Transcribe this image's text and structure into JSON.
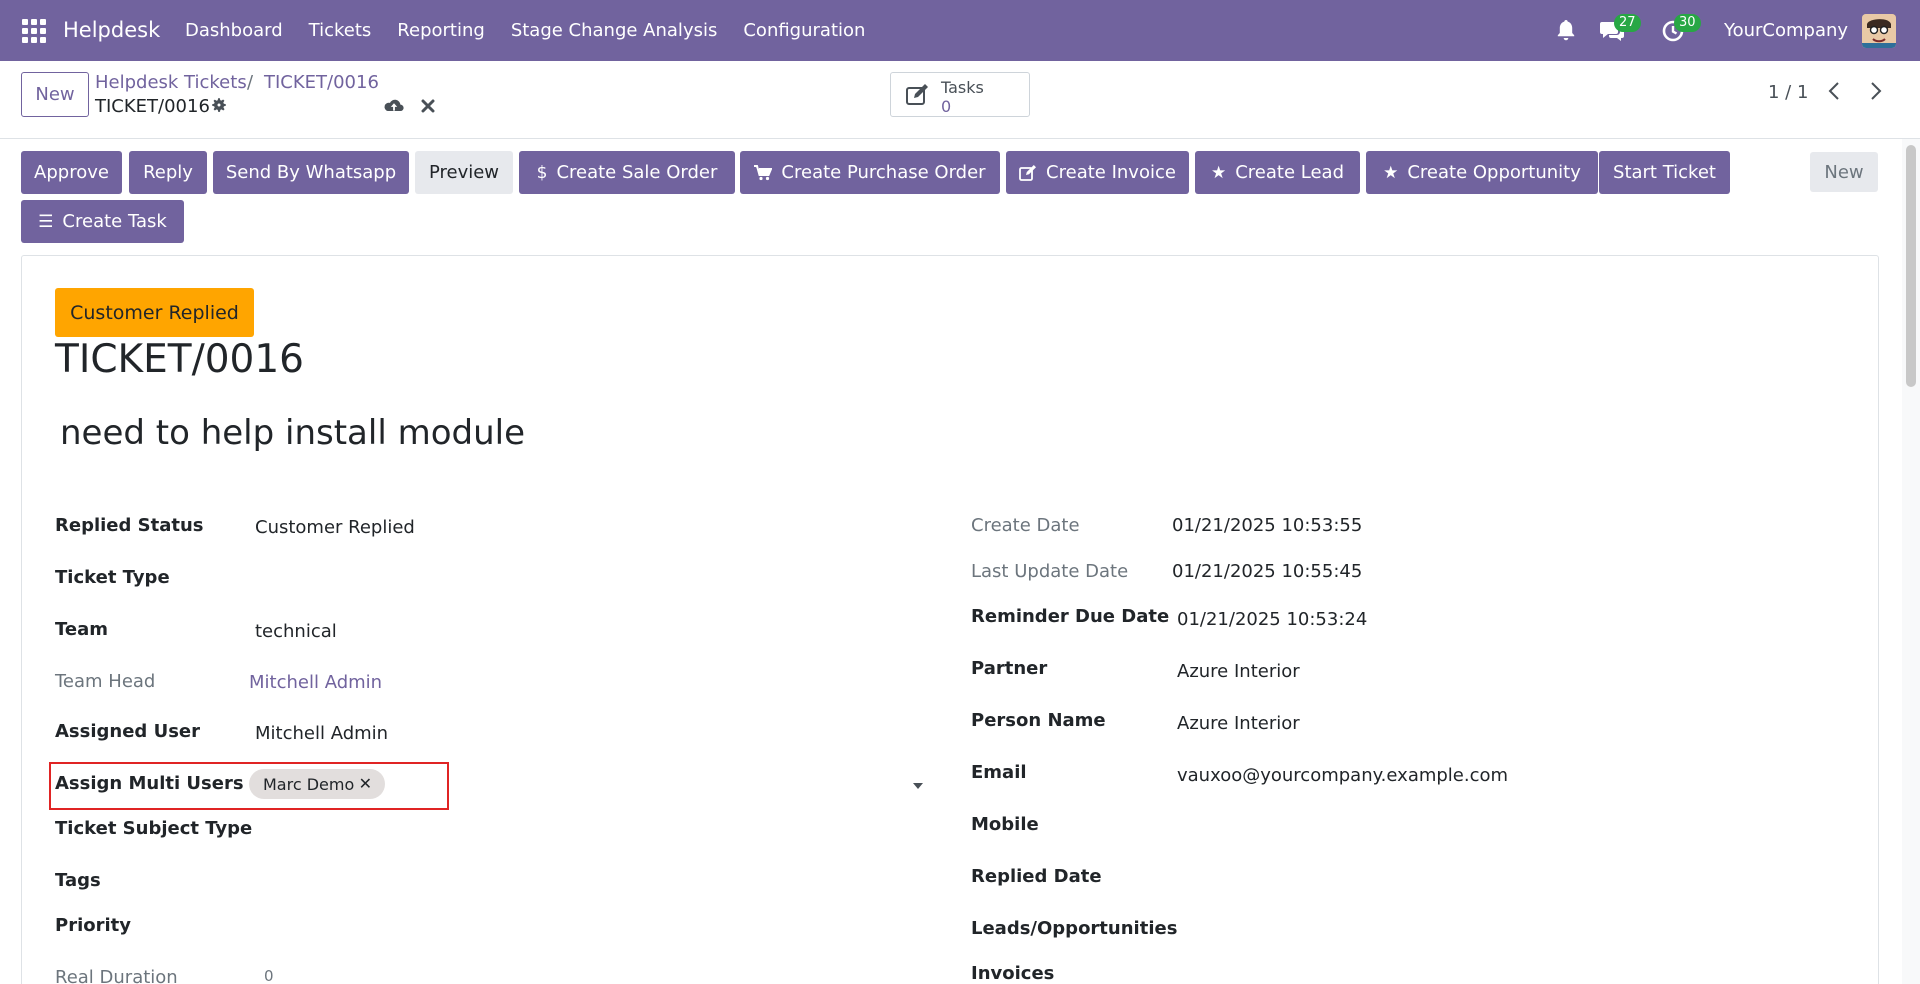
{
  "navbar": {
    "brand": "Helpdesk",
    "menu": [
      "Dashboard",
      "Tickets",
      "Reporting",
      "Stage Change Analysis",
      "Configuration"
    ],
    "messages_count": "27",
    "activities_count": "30",
    "company": "YourCompany"
  },
  "control_panel": {
    "new_label": "New",
    "breadcrumb_parent": "Helpdesk Tickets",
    "breadcrumb_separator": "/",
    "breadcrumb_current": "TICKET/0016",
    "record_name": "TICKET/0016",
    "tasks_label": "Tasks",
    "tasks_count": "0",
    "pager": "1 / 1"
  },
  "header_buttons": {
    "approve": "Approve",
    "reply": "Reply",
    "whatsapp": "Send By Whatsapp",
    "preview": "Preview",
    "sale_order": "Create Sale Order",
    "purchase_order": "Create Purchase Order",
    "invoice": "Create Invoice",
    "lead": "Create Lead",
    "opportunity": "Create Opportunity",
    "start_ticket": "Start Ticket",
    "create_task": "Create Task",
    "status_new": "New"
  },
  "form": {
    "state_badge": "Customer Replied",
    "title": "TICKET/0016",
    "subject": "need to help install module",
    "left": {
      "replied_status_label": "Replied Status",
      "replied_status_value": "Customer Replied",
      "ticket_type_label": "Ticket Type",
      "team_label": "Team",
      "team_value": "technical",
      "team_head_label": "Team Head",
      "team_head_value": "Mitchell Admin",
      "assigned_user_label": "Assigned User",
      "assigned_user_value": "Mitchell Admin",
      "assign_multi_label": "Assign Multi Users",
      "assign_multi_tag": "Marc Demo",
      "ticket_subject_type_label": "Ticket Subject Type",
      "tags_label": "Tags",
      "priority_label": "Priority",
      "real_duration_label": "Real Duration",
      "real_duration_value": "0"
    },
    "right": {
      "create_date_label": "Create Date",
      "create_date_value": "01/21/2025 10:53:55",
      "last_update_label": "Last Update Date",
      "last_update_value": "01/21/2025 10:55:45",
      "reminder_label": "Reminder Due Date",
      "reminder_value": "01/21/2025 10:53:24",
      "partner_label": "Partner",
      "partner_value": "Azure Interior",
      "person_name_label": "Person Name",
      "person_name_value": "Azure Interior",
      "email_label": "Email",
      "email_value": "vauxoo@yourcompany.example.com",
      "mobile_label": "Mobile",
      "replied_date_label": "Replied Date",
      "leads_label": "Leads/Opportunities",
      "invoices_label": "Invoices"
    }
  },
  "colors": {
    "brand": "#71639e",
    "badge_green": "#28a745",
    "state_orange": "#ffa500",
    "highlight_red": "#e02424"
  }
}
